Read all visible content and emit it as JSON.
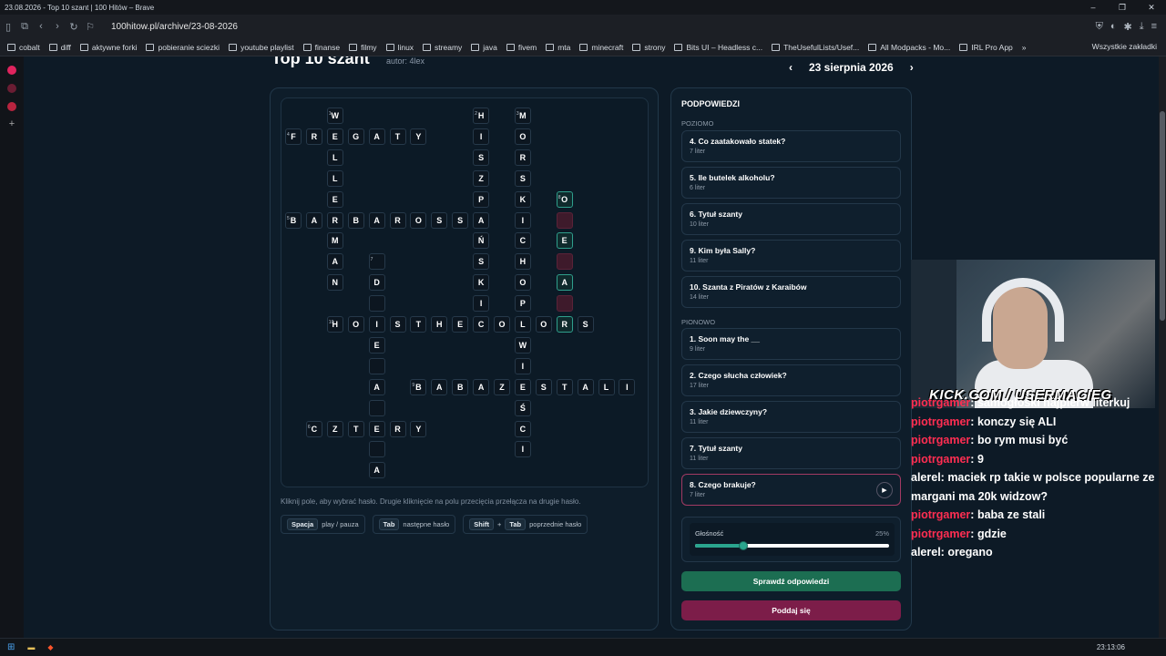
{
  "window": {
    "title": "23.08.2026 - Top 10 szant | 100 Hitów – Brave"
  },
  "browser": {
    "url": "100hitow.pl/archive/23-08-2026",
    "bookmarks": [
      "cobalt",
      "diff",
      "aktywne forki",
      "pobieranie sciezki",
      "youtube playlist",
      "finanse",
      "filmy",
      "linux",
      "streamy",
      "java",
      "fivem",
      "mta",
      "minecraft",
      "strony",
      "Bits UI – Headless c...",
      "TheUsefulLists/Usef...",
      "All Modpacks - Mo...",
      "IRL Pro App"
    ],
    "bookmarks_more": "»",
    "all_bookmarks": "Wszystkie zakładki"
  },
  "page": {
    "title": "Top 10 szant",
    "author_label": "autor:",
    "author": "4lex",
    "date": "23 sierpnia 2026",
    "prev": "‹",
    "next": "›"
  },
  "grid": {
    "cells": [
      {
        "r": 0,
        "c": 2,
        "ch": "W",
        "n": "1"
      },
      {
        "r": 0,
        "c": 9,
        "ch": "H",
        "n": "2"
      },
      {
        "r": 0,
        "c": 11,
        "ch": "M",
        "n": "3"
      },
      {
        "r": 1,
        "c": 0,
        "ch": "F",
        "n": "4"
      },
      {
        "r": 1,
        "c": 1,
        "ch": "R"
      },
      {
        "r": 1,
        "c": 2,
        "ch": "E"
      },
      {
        "r": 1,
        "c": 3,
        "ch": "G"
      },
      {
        "r": 1,
        "c": 4,
        "ch": "A"
      },
      {
        "r": 1,
        "c": 5,
        "ch": "T"
      },
      {
        "r": 1,
        "c": 6,
        "ch": "Y"
      },
      {
        "r": 1,
        "c": 9,
        "ch": "I"
      },
      {
        "r": 1,
        "c": 11,
        "ch": "O"
      },
      {
        "r": 2,
        "c": 2,
        "ch": "L"
      },
      {
        "r": 2,
        "c": 9,
        "ch": "S"
      },
      {
        "r": 2,
        "c": 11,
        "ch": "R"
      },
      {
        "r": 3,
        "c": 2,
        "ch": "L"
      },
      {
        "r": 3,
        "c": 9,
        "ch": "Z"
      },
      {
        "r": 3,
        "c": 11,
        "ch": "S"
      },
      {
        "r": 4,
        "c": 2,
        "ch": "E"
      },
      {
        "r": 4,
        "c": 9,
        "ch": "P"
      },
      {
        "r": 4,
        "c": 11,
        "ch": "K"
      },
      {
        "r": 4,
        "c": 13,
        "ch": "O",
        "n": "8",
        "hl": true
      },
      {
        "r": 5,
        "c": 0,
        "ch": "B",
        "n": "5"
      },
      {
        "r": 5,
        "c": 1,
        "ch": "A"
      },
      {
        "r": 5,
        "c": 2,
        "ch": "R"
      },
      {
        "r": 5,
        "c": 3,
        "ch": "B"
      },
      {
        "r": 5,
        "c": 4,
        "ch": "A"
      },
      {
        "r": 5,
        "c": 5,
        "ch": "R"
      },
      {
        "r": 5,
        "c": 6,
        "ch": "O"
      },
      {
        "r": 5,
        "c": 7,
        "ch": "S"
      },
      {
        "r": 5,
        "c": 8,
        "ch": "S"
      },
      {
        "r": 5,
        "c": 9,
        "ch": "A"
      },
      {
        "r": 5,
        "c": 11,
        "ch": "I"
      },
      {
        "r": 5,
        "c": 13,
        "ch": "",
        "red": true
      },
      {
        "r": 6,
        "c": 2,
        "ch": "M"
      },
      {
        "r": 6,
        "c": 9,
        "ch": "Ń"
      },
      {
        "r": 6,
        "c": 11,
        "ch": "C"
      },
      {
        "r": 6,
        "c": 13,
        "ch": "E",
        "hl": true
      },
      {
        "r": 7,
        "c": 2,
        "ch": "A"
      },
      {
        "r": 7,
        "c": 4,
        "ch": "",
        "n": "7"
      },
      {
        "r": 7,
        "c": 9,
        "ch": "S"
      },
      {
        "r": 7,
        "c": 11,
        "ch": "H"
      },
      {
        "r": 7,
        "c": 13,
        "ch": "",
        "red": true
      },
      {
        "r": 8,
        "c": 2,
        "ch": "N"
      },
      {
        "r": 8,
        "c": 4,
        "ch": "D"
      },
      {
        "r": 8,
        "c": 9,
        "ch": "K"
      },
      {
        "r": 8,
        "c": 11,
        "ch": "O"
      },
      {
        "r": 8,
        "c": 13,
        "ch": "A",
        "hl": true
      },
      {
        "r": 9,
        "c": 4,
        "ch": ""
      },
      {
        "r": 9,
        "c": 9,
        "ch": "I"
      },
      {
        "r": 9,
        "c": 11,
        "ch": "P"
      },
      {
        "r": 9,
        "c": 13,
        "ch": "",
        "red": true
      },
      {
        "r": 10,
        "c": 2,
        "ch": "H",
        "n": "10"
      },
      {
        "r": 10,
        "c": 3,
        "ch": "O"
      },
      {
        "r": 10,
        "c": 4,
        "ch": "I"
      },
      {
        "r": 10,
        "c": 5,
        "ch": "S"
      },
      {
        "r": 10,
        "c": 6,
        "ch": "T"
      },
      {
        "r": 10,
        "c": 7,
        "ch": "H"
      },
      {
        "r": 10,
        "c": 8,
        "ch": "E"
      },
      {
        "r": 10,
        "c": 9,
        "ch": "C"
      },
      {
        "r": 10,
        "c": 10,
        "ch": "O"
      },
      {
        "r": 10,
        "c": 11,
        "ch": "L"
      },
      {
        "r": 10,
        "c": 12,
        "ch": "O"
      },
      {
        "r": 10,
        "c": 13,
        "ch": "R",
        "hl": true
      },
      {
        "r": 10,
        "c": 14,
        "ch": "S"
      },
      {
        "r": 11,
        "c": 4,
        "ch": "E"
      },
      {
        "r": 11,
        "c": 11,
        "ch": "W"
      },
      {
        "r": 12,
        "c": 4,
        "ch": ""
      },
      {
        "r": 12,
        "c": 11,
        "ch": "I"
      },
      {
        "r": 13,
        "c": 4,
        "ch": "A"
      },
      {
        "r": 13,
        "c": 6,
        "ch": "B",
        "n": "9"
      },
      {
        "r": 13,
        "c": 7,
        "ch": "A"
      },
      {
        "r": 13,
        "c": 8,
        "ch": "B"
      },
      {
        "r": 13,
        "c": 9,
        "ch": "A"
      },
      {
        "r": 13,
        "c": 10,
        "ch": "Z"
      },
      {
        "r": 13,
        "c": 11,
        "ch": "E"
      },
      {
        "r": 13,
        "c": 12,
        "ch": "S"
      },
      {
        "r": 13,
        "c": 13,
        "ch": "T"
      },
      {
        "r": 13,
        "c": 14,
        "ch": "A"
      },
      {
        "r": 13,
        "c": 15,
        "ch": "L"
      },
      {
        "r": 13,
        "c": 16,
        "ch": "I"
      },
      {
        "r": 14,
        "c": 4,
        "ch": ""
      },
      {
        "r": 14,
        "c": 11,
        "ch": "Ś"
      },
      {
        "r": 15,
        "c": 1,
        "ch": "C",
        "n": "6"
      },
      {
        "r": 15,
        "c": 2,
        "ch": "Z"
      },
      {
        "r": 15,
        "c": 3,
        "ch": "T"
      },
      {
        "r": 15,
        "c": 4,
        "ch": "E"
      },
      {
        "r": 15,
        "c": 5,
        "ch": "R"
      },
      {
        "r": 15,
        "c": 6,
        "ch": "Y"
      },
      {
        "r": 15,
        "c": 11,
        "ch": "C"
      },
      {
        "r": 16,
        "c": 4,
        "ch": ""
      },
      {
        "r": 16,
        "c": 11,
        "ch": "I"
      },
      {
        "r": 17,
        "c": 4,
        "ch": "A"
      }
    ]
  },
  "help": {
    "text": "Kliknij pole, aby wybrać hasło. Drugie kliknięcie na polu przecięcia przełącza na drugie hasło.",
    "keys": [
      {
        "keys": [
          "Spacja"
        ],
        "label": "play / pauza"
      },
      {
        "keys": [
          "Tab"
        ],
        "label": "następne hasło"
      },
      {
        "keys": [
          "Shift",
          "+",
          "Tab"
        ],
        "label": "poprzednie hasło"
      }
    ]
  },
  "hints": {
    "title": "PODPOWIEDZI",
    "across_label": "POZIOMO",
    "down_label": "PIONOWO",
    "across": [
      {
        "title": "4. Co zaatakowało statek?",
        "len": "7 liter"
      },
      {
        "title": "5. Ile butelek alkoholu?",
        "len": "6 liter"
      },
      {
        "title": "6. Tytuł szanty",
        "len": "10 liter"
      },
      {
        "title": "9. Kim była Sally?",
        "len": "11 liter"
      },
      {
        "title": "10. Szanta z Piratów z Karaibów",
        "len": "14 liter"
      }
    ],
    "down": [
      {
        "title": "1. Soon may the __",
        "len": "9 liter"
      },
      {
        "title": "2. Czego słucha człowiek?",
        "len": "17 liter"
      },
      {
        "title": "3. Jakie dziewczyny?",
        "len": "11 liter"
      },
      {
        "title": "7. Tytuł szanty",
        "len": "11 liter"
      },
      {
        "title": "8. Czego brakuje?",
        "len": "7 liter",
        "active": true
      }
    ],
    "play_icon": "▶",
    "volume_label": "Głośność",
    "volume_value": "25%",
    "volume_fraction": 0.25,
    "check_button": "Sprawdź odpowiedzi",
    "giveup_button": "Poddaj się"
  },
  "stream": {
    "overlay_text": "KICK.COM / USERMACIEG",
    "chat": [
      {
        "user": "piotrgamer",
        "msg": "samogłoski najpierw literkuj"
      },
      {
        "user": "piotrgamer",
        "msg": "konczy się ALI"
      },
      {
        "user": "piotrgamer",
        "msg": "bo rym musi być"
      },
      {
        "user": "piotrgamer",
        "msg": "9"
      },
      {
        "user": "alerel",
        "msg": "maciek rp takie w polsce popularne ze margani ma 20k widzow?",
        "white": true
      },
      {
        "user": "piotrgamer",
        "msg": "baba ze stali"
      },
      {
        "user": "piotrgamer",
        "msg": "gdzie"
      },
      {
        "user": "alerel",
        "msg": "oregano",
        "white": true
      }
    ]
  },
  "taskbar": {
    "clock": "23:13:06"
  }
}
